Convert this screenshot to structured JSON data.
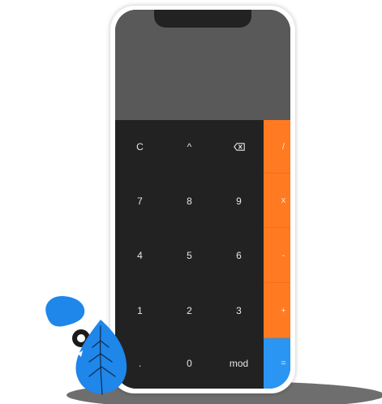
{
  "calculator": {
    "display": {
      "expression": "",
      "result": ""
    },
    "keys": {
      "row1": {
        "clear": "C",
        "power": "^",
        "backspace_icon": "backspace-icon",
        "divide": "/"
      },
      "row2": {
        "seven": "7",
        "eight": "8",
        "nine": "9",
        "multiply": "x"
      },
      "row3": {
        "four": "4",
        "five": "5",
        "six": "6",
        "subtract": "-"
      },
      "row4": {
        "one": "1",
        "two": "2",
        "three": "3",
        "add": "+"
      },
      "row5": {
        "decimal": ".",
        "zero": "0",
        "mod": "mod",
        "equals": "="
      }
    }
  },
  "colors": {
    "display_bg": "#595959",
    "keypad_bg": "#222222",
    "operator_bg": "#ff7a21",
    "equals_bg": "#2a95f3",
    "plant_blue": "#1f86ea",
    "floor_shadow": "#6e6e6e"
  }
}
